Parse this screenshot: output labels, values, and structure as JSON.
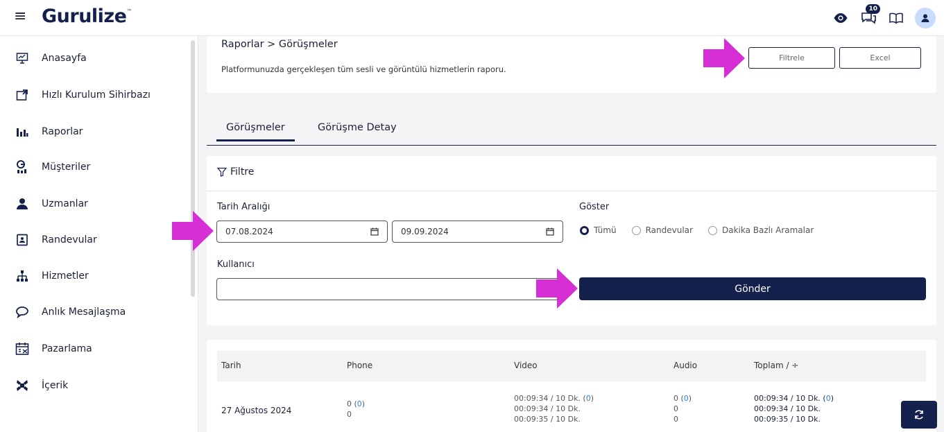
{
  "header": {
    "logo": "Gurulize",
    "logo_tm": "™",
    "notification_count": "10"
  },
  "sidebar": {
    "items": [
      {
        "label": "Anasayfa",
        "icon": "dashboard-icon"
      },
      {
        "label": "Hızlı Kurulum Sihirbazı",
        "icon": "setup-wizard-icon"
      },
      {
        "label": "Raporlar",
        "icon": "bar-chart-icon"
      },
      {
        "label": "Müşteriler",
        "icon": "customers-icon"
      },
      {
        "label": "Uzmanlar",
        "icon": "expert-icon"
      },
      {
        "label": "Randevular",
        "icon": "appointment-icon"
      },
      {
        "label": "Hizmetler",
        "icon": "services-icon"
      },
      {
        "label": "Anlık Mesajlaşma",
        "icon": "chat-icon"
      },
      {
        "label": "Pazarlama",
        "icon": "marketing-icon"
      },
      {
        "label": "İçerik",
        "icon": "content-icon"
      }
    ]
  },
  "page": {
    "breadcrumb": "Raporlar > Görüşmeler",
    "subtitle": "Platformunuzda gerçekleşen tüm sesli ve görüntülü hizmetlerin raporu.",
    "filter_button": "Filtrele",
    "excel_button": "Excel"
  },
  "tabs": [
    {
      "label": "Görüşmeler",
      "active": true
    },
    {
      "label": "Görüşme Detay",
      "active": false
    }
  ],
  "filter": {
    "title": "Filtre",
    "date_range_label": "Tarih Aralığı",
    "start_date": "07.08.2024",
    "end_date": "09.09.2024",
    "show_label": "Göster",
    "show_options": [
      "Tümü",
      "Randevular",
      "Dakika Bazlı Aramalar"
    ],
    "show_selected": "Tümü",
    "user_label": "Kullanıcı",
    "user_value": "",
    "submit_label": "Gönder"
  },
  "table": {
    "columns": [
      "Tarih",
      "Phone",
      "Video",
      "Audio",
      "Toplam / ÷"
    ],
    "rows": [
      {
        "date": "27 Ağustos 2024",
        "phone_main": "0",
        "phone_paren": "0",
        "phone_sub": "0",
        "video_line1": "00:09:34 / 10 Dk.",
        "video_paren": "0",
        "video_line2": "00:09:34 / 10 Dk.",
        "video_line3": "00:09:35 / 10 Dk.",
        "audio_main": "0",
        "audio_paren": "0",
        "audio_line2": "0",
        "audio_line3": "0",
        "total_line1": "00:09:34 / 10 Dk.",
        "total_paren": "0",
        "total_line2": "00:09:34 / 10 Dk.",
        "total_line3": "00:09:35 / 10 Dk."
      }
    ]
  },
  "colors": {
    "primary": "#14214d",
    "annotation_arrow": "#d62fd6",
    "link_blue": "#2b7de9"
  }
}
